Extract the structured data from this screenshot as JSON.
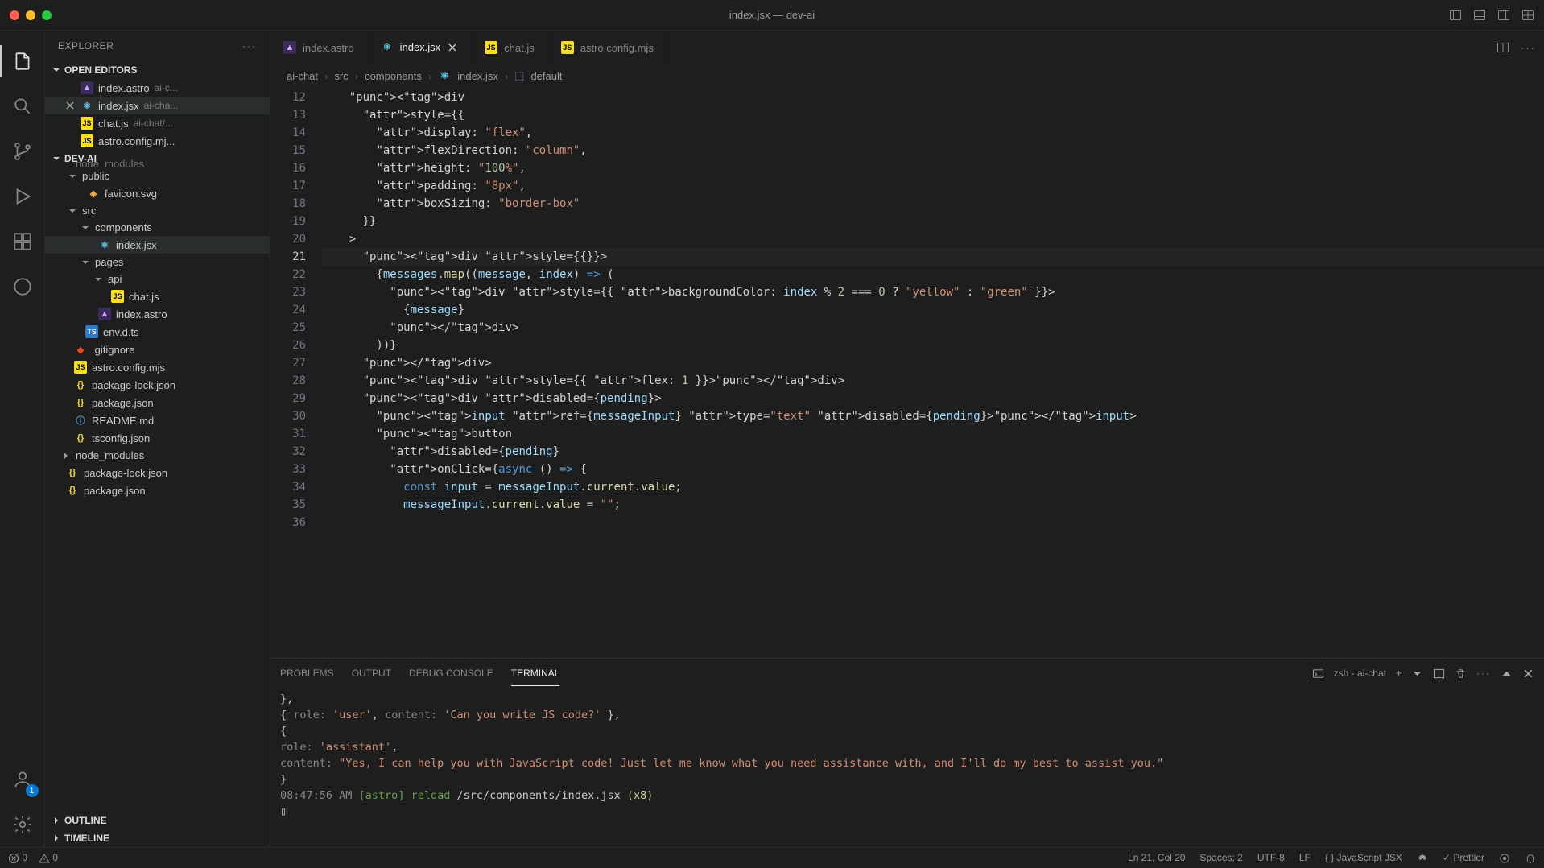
{
  "window": {
    "title": "index.jsx — dev-ai"
  },
  "explorer": {
    "title": "EXPLORER",
    "openEditors": {
      "label": "OPEN EDITORS",
      "items": [
        {
          "name": "index.astro",
          "hint": "ai-c..."
        },
        {
          "name": "index.jsx",
          "hint": "ai-cha...",
          "active": true
        },
        {
          "name": "chat.js",
          "hint": "ai-chat/..."
        },
        {
          "name": "astro.config.mj...",
          "hint": ""
        }
      ]
    },
    "workspace": {
      "label": "DEV-AI",
      "tree": {
        "node_modules_cut": "node_modules",
        "public": "public",
        "favicon": "favicon.svg",
        "src": "src",
        "components": "components",
        "indexjsx": "index.jsx",
        "pages": "pages",
        "api": "api",
        "chatjs": "chat.js",
        "indexastro": "index.astro",
        "envdts": "env.d.ts",
        "gitignore": ".gitignore",
        "astroconfig": "astro.config.mjs",
        "pkglock": "package-lock.json",
        "pkg": "package.json",
        "readme": "README.md",
        "tsconfig": "tsconfig.json",
        "nodemod2": "node_modules",
        "pkglock2": "package-lock.json",
        "pkg2": "package.json"
      }
    },
    "outline": "OUTLINE",
    "timeline": "TIMELINE"
  },
  "tabs": [
    {
      "name": "index.astro",
      "icon": "astro"
    },
    {
      "name": "index.jsx",
      "icon": "react",
      "active": true
    },
    {
      "name": "chat.js",
      "icon": "js"
    },
    {
      "name": "astro.config.mjs",
      "icon": "js"
    }
  ],
  "breadcrumb": [
    "ai-chat",
    "src",
    "components",
    "index.jsx",
    "default"
  ],
  "editor": {
    "startLine": 12,
    "activeLine": 21,
    "lines": [
      "    <div",
      "      style={{",
      "        display: \"flex\",",
      "        flexDirection: \"column\",",
      "        height: \"100%\",",
      "        padding: \"8px\",",
      "        boxSizing: \"border-box\"",
      "      }}",
      "    >",
      "      <div style={{}}>",
      "        {messages.map((message, index) => (",
      "          <div style={{ backgroundColor: index % 2 === 0 ? \"yellow\" : \"green\" }}>",
      "            {message}",
      "          </div>",
      "        ))}",
      "      </div>",
      "      <div style={{ flex: 1 }}></div>",
      "      <div disabled={pending}>",
      "        <input ref={messageInput} type=\"text\" disabled={pending}></input>",
      "        <button",
      "          disabled={pending}",
      "          onClick={async () => {",
      "            const input = messageInput.current.value;",
      "            messageInput.current.value = \"\";",
      ""
    ]
  },
  "panel": {
    "tabs": {
      "problems": "PROBLEMS",
      "output": "OUTPUT",
      "debug": "DEBUG CONSOLE",
      "terminal": "TERMINAL"
    },
    "shell": "zsh - ai-chat",
    "terminal": {
      "l1": "  },",
      "l2": "  { role: 'user', content: 'Can you write JS code?' },",
      "l3": "  {",
      "l4": "    role: 'assistant',",
      "l5": "    content: \"Yes, I can help you with JavaScript code! Just let me know what you need assistance with, and I'll do my best to assist you.\"",
      "l6": "  }",
      "l7_time": "08:47:56 AM",
      "l7_tag": "[astro]",
      "l7_action": "reload",
      "l7_path": "/src/components/index.jsx",
      "l7_count": "(x8)"
    }
  },
  "status": {
    "errors": "0",
    "warnings": "0",
    "pos": "Ln 21, Col 20",
    "spaces": "Spaces: 2",
    "encoding": "UTF-8",
    "eol": "LF",
    "lang": "JavaScript JSX",
    "prettier": "Prettier"
  },
  "activity": {
    "badge": "1"
  }
}
